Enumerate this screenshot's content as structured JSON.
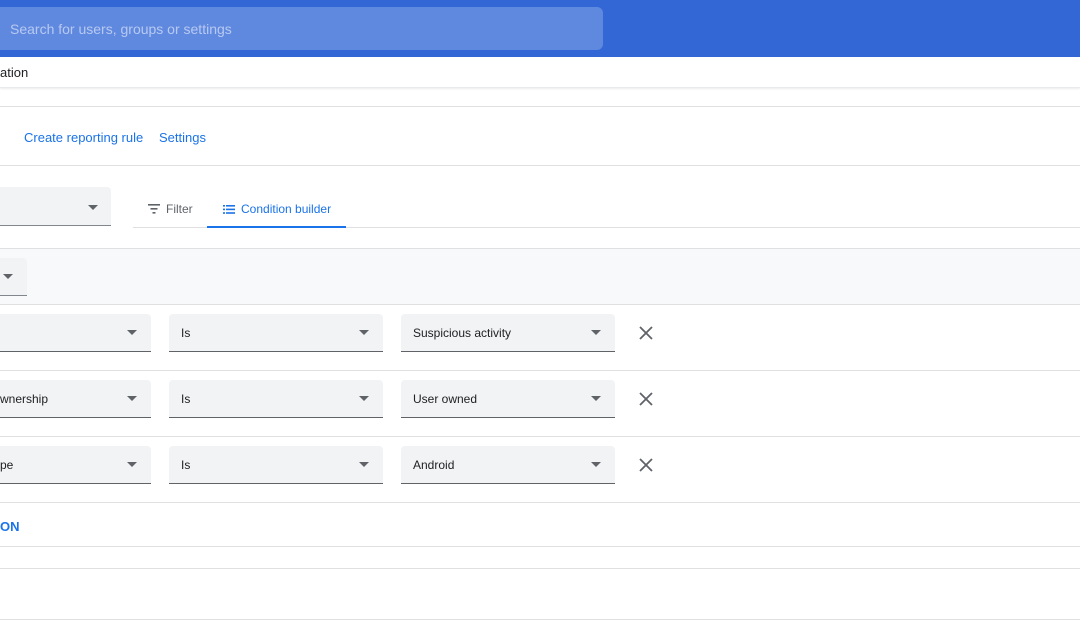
{
  "search": {
    "placeholder": "Search for users, groups or settings"
  },
  "breadcrumb": {
    "text": "ation"
  },
  "actions": {
    "create_rule": "Create reporting rule",
    "settings": "Settings"
  },
  "tabs": [
    {
      "label": "Filter",
      "icon": "filter-icon",
      "active": false
    },
    {
      "label": "Condition builder",
      "icon": "list-icon",
      "active": true
    }
  ],
  "conditions": [
    {
      "attribute": "",
      "operator": "Is",
      "value": "Suspicious activity"
    },
    {
      "attribute": "wnership",
      "operator": "Is",
      "value": "User owned"
    },
    {
      "attribute": "pe",
      "operator": "Is",
      "value": "Android"
    }
  ],
  "add_condition": {
    "label": "ON"
  },
  "colors": {
    "header": "#3367d6",
    "accent": "#1a73e8",
    "field_bg": "#f1f3f4"
  }
}
